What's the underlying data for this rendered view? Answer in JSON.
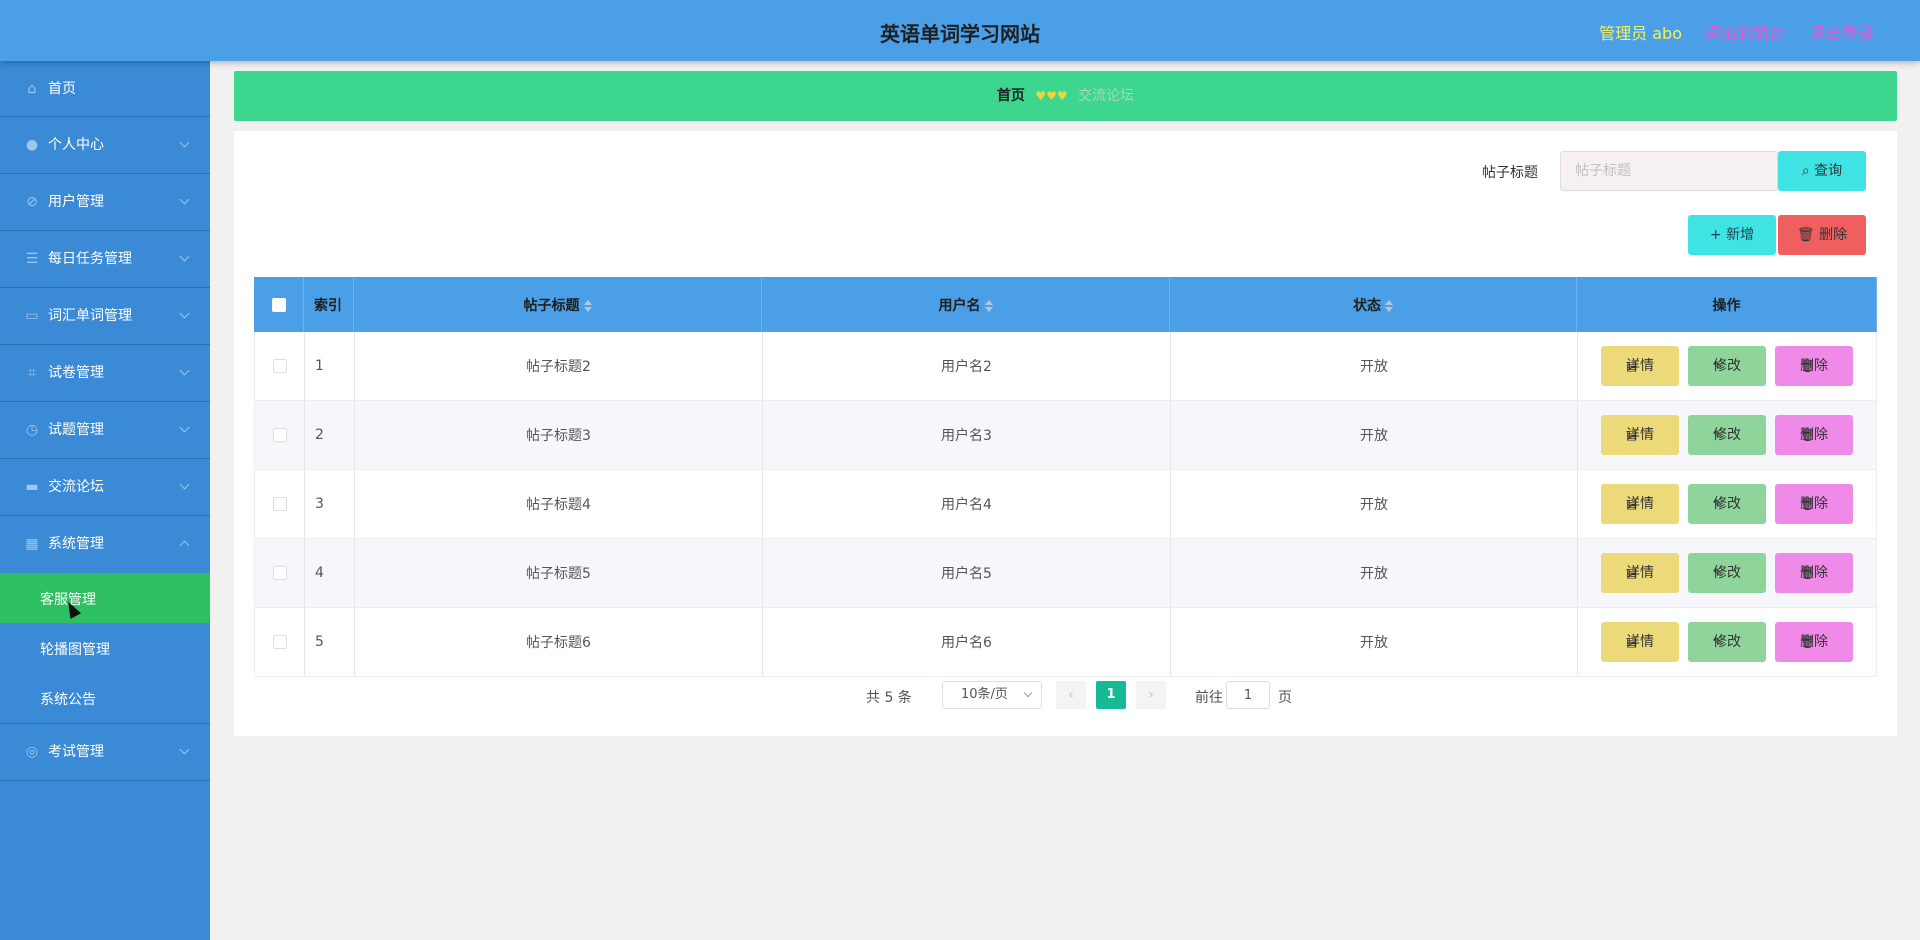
{
  "header": {
    "title": "英语单词学习网站",
    "user_label": "管理员 abo",
    "front_link": "退出到前台",
    "logout_link": "退出登录"
  },
  "sidebar": {
    "items": [
      {
        "label": "首页",
        "icon": "home-icon"
      },
      {
        "label": "个人中心",
        "icon": "user-icon"
      },
      {
        "label": "用户管理",
        "icon": "leaf-icon"
      },
      {
        "label": "每日任务管理",
        "icon": "list-icon"
      },
      {
        "label": "词汇单词管理",
        "icon": "chat-icon"
      },
      {
        "label": "试卷管理",
        "icon": "crop-icon"
      },
      {
        "label": "试题管理",
        "icon": "clock-icon"
      },
      {
        "label": "交流论坛",
        "icon": "ticket-icon"
      },
      {
        "label": "系统管理",
        "icon": "grid-icon"
      },
      {
        "label": "考试管理",
        "icon": "target-icon"
      }
    ],
    "sub_items": [
      {
        "label": "客服管理",
        "active": true
      },
      {
        "label": "轮播图管理",
        "active": false
      },
      {
        "label": "系统公告",
        "active": false
      }
    ]
  },
  "breadcrumb": {
    "home": "首页",
    "separator": "♥♥♥",
    "current": "交流论坛"
  },
  "search": {
    "label": "帖子标题",
    "placeholder": "帖子标题",
    "query_button": "查询"
  },
  "toolbar": {
    "add_button": "新增",
    "delete_button": "删除"
  },
  "table": {
    "columns": [
      "索引",
      "帖子标题",
      "用户名",
      "状态",
      "操作"
    ],
    "rows": [
      {
        "index": "1",
        "title": "帖子标题2",
        "username": "用户名2",
        "status": "开放"
      },
      {
        "index": "2",
        "title": "帖子标题3",
        "username": "用户名3",
        "status": "开放"
      },
      {
        "index": "3",
        "title": "帖子标题4",
        "username": "用户名4",
        "status": "开放"
      },
      {
        "index": "4",
        "title": "帖子标题5",
        "username": "用户名5",
        "status": "开放"
      },
      {
        "index": "5",
        "title": "帖子标题6",
        "username": "用户名6",
        "status": "开放"
      }
    ],
    "actions": {
      "detail": "详情",
      "edit": "修改",
      "remove": "删除"
    }
  },
  "pager": {
    "total": "共 5 条",
    "page_size": "10条/页",
    "current_page": "1",
    "goto_label": "前往",
    "goto_value": "1",
    "page_unit": "页"
  },
  "colors": {
    "header": "#4a9fe6",
    "sidebar": "#3a8ad6",
    "active_sub": "#2ebf62",
    "breadcrumb": "#3dd68f",
    "pager_active": "#18b995"
  }
}
